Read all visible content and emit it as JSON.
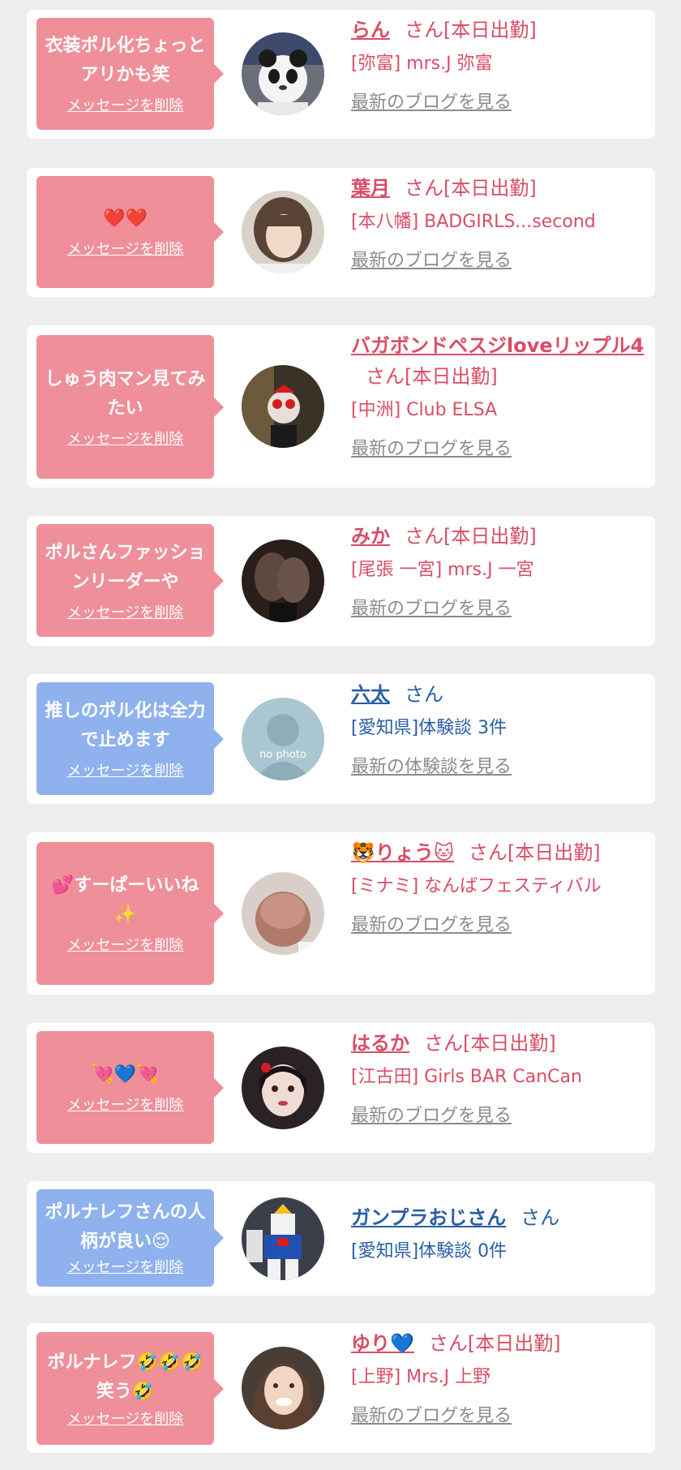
{
  "delete_label": "メッセージを削除",
  "colors": {
    "pink": "#ee8f9a",
    "blue": "#8fb2ee",
    "pink_text": "#d94d66",
    "blue_text": "#2a5ea5",
    "link_gray": "#8b8b8b"
  },
  "items": [
    {
      "message": "衣装ポル化ちょっとアリかも笑",
      "name": "らん",
      "suffix": "さん[本日出勤]",
      "shop": "[弥富] mrs.J 弥富",
      "link": "最新のブログを見る",
      "avatar_icon": "panda-plush-photo"
    },
    {
      "message": "❤️❤️",
      "name": "葉月",
      "suffix": "さん[本日出勤]",
      "shop": "[本八幡] BADGIRLS...second",
      "link": "最新のブログを見る",
      "avatar_icon": "girl-portrait-photo"
    },
    {
      "message": "しゅう肉マン見てみたい",
      "name": "バガボンドペスジloveリップル4",
      "suffix": "さん[本日出勤]",
      "shop": "[中洲] Club ELSA",
      "link": "最新のブログを見る",
      "avatar_icon": "masked-character-photo"
    },
    {
      "message": "ポルさんファッションリーダーや",
      "name": "みか",
      "suffix": "さん[本日出勤]",
      "shop": "[尾張 一宮] mrs.J 一宮",
      "link": "最新のブログを見る",
      "avatar_icon": "legs-photo"
    },
    {
      "message": "推しのポル化は全力で止めます",
      "name": "六太",
      "suffix": "さん",
      "shop": "[愛知県]体験談 3件",
      "link": "最新の体験談を見る",
      "avatar_icon": "no-photo-silhouette",
      "no_photo": "no photo"
    },
    {
      "message": "💕すーぱーいいね✨",
      "name": "🐯りょう🐱",
      "suffix": "さん[本日出勤]",
      "shop": "[ミナミ] なんばフェスティバル",
      "link": "最新のブログを見る",
      "avatar_icon": "hair-photo"
    },
    {
      "message": "💘💙💘",
      "name": "はるか",
      "suffix": "さん[本日出勤]",
      "shop": "[江古田] Girls BAR CanCan",
      "link": "最新のブログを見る",
      "avatar_icon": "girl-face-photo"
    },
    {
      "message": "ポルナレフさんの人柄が良い😌",
      "name": "ガンプラおじさん",
      "suffix": "さん",
      "shop": "[愛知県]体験談 0件",
      "link": "",
      "avatar_icon": "gundam-model-photo"
    },
    {
      "message": "ポルナレフ🤣🤣🤣笑う🤣",
      "name": "ゆり💙",
      "suffix": "さん[本日出勤]",
      "shop": "[上野] Mrs.J 上野",
      "link": "最新のブログを見る",
      "avatar_icon": "smiling-woman-photo"
    }
  ]
}
